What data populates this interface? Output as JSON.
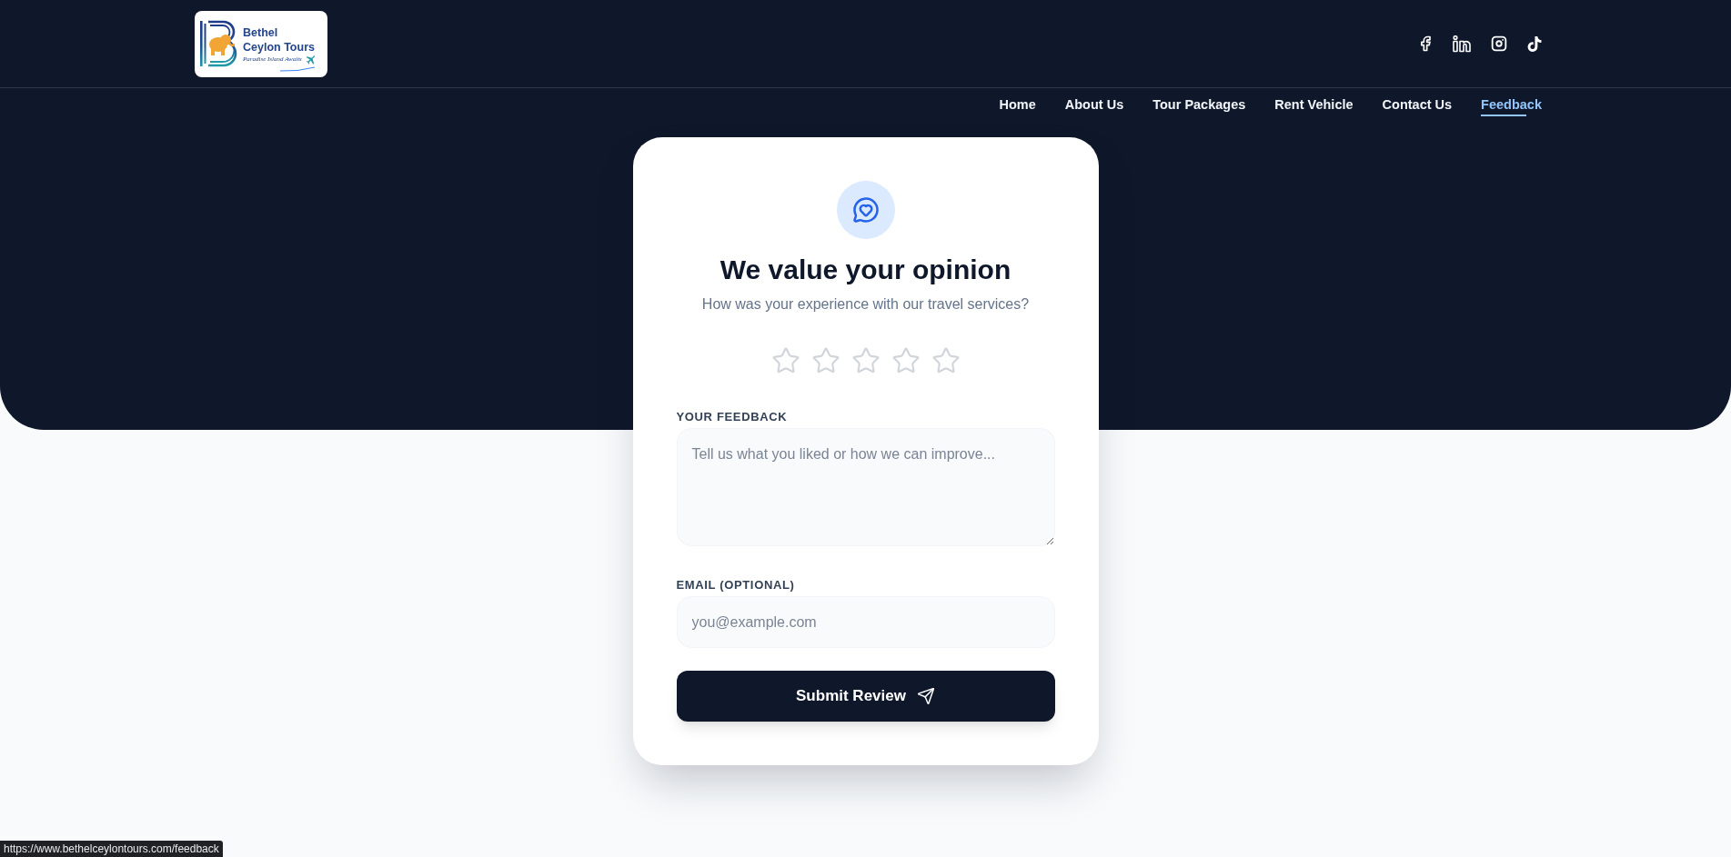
{
  "logo": {
    "name_lines": [
      "Bethel",
      "Ceylon Tours"
    ],
    "tagline": "Paradise Island Awaits"
  },
  "social_links": [
    {
      "kind": "facebook"
    },
    {
      "kind": "linkedin"
    },
    {
      "kind": "instagram"
    },
    {
      "kind": "tiktok"
    }
  ],
  "nav": [
    {
      "label": "Home",
      "selected": false
    },
    {
      "label": "About Us",
      "selected": false
    },
    {
      "label": "Tour Packages",
      "selected": false
    },
    {
      "label": "Rent Vehicle",
      "selected": false
    },
    {
      "label": "Contact Us",
      "selected": false
    },
    {
      "label": "Feedback",
      "selected": true
    }
  ],
  "feedback_card": {
    "title": "We value your opinion",
    "subtitle": "How was your experience with our travel services?",
    "rating": {
      "stars": 0
    },
    "fields": [
      {
        "kind": "textarea",
        "label": "YOUR FEEDBACK",
        "placeholder": "Tell us what you liked or how we can improve..."
      },
      {
        "kind": "input",
        "label": "EMAIL (OPTIONAL)",
        "placeholder": "you@example.com"
      }
    ],
    "submit_button": {
      "label": "Submit Review"
    }
  },
  "status_bar": {
    "url": "https://www.bethelceylontours.com/feedback"
  }
}
